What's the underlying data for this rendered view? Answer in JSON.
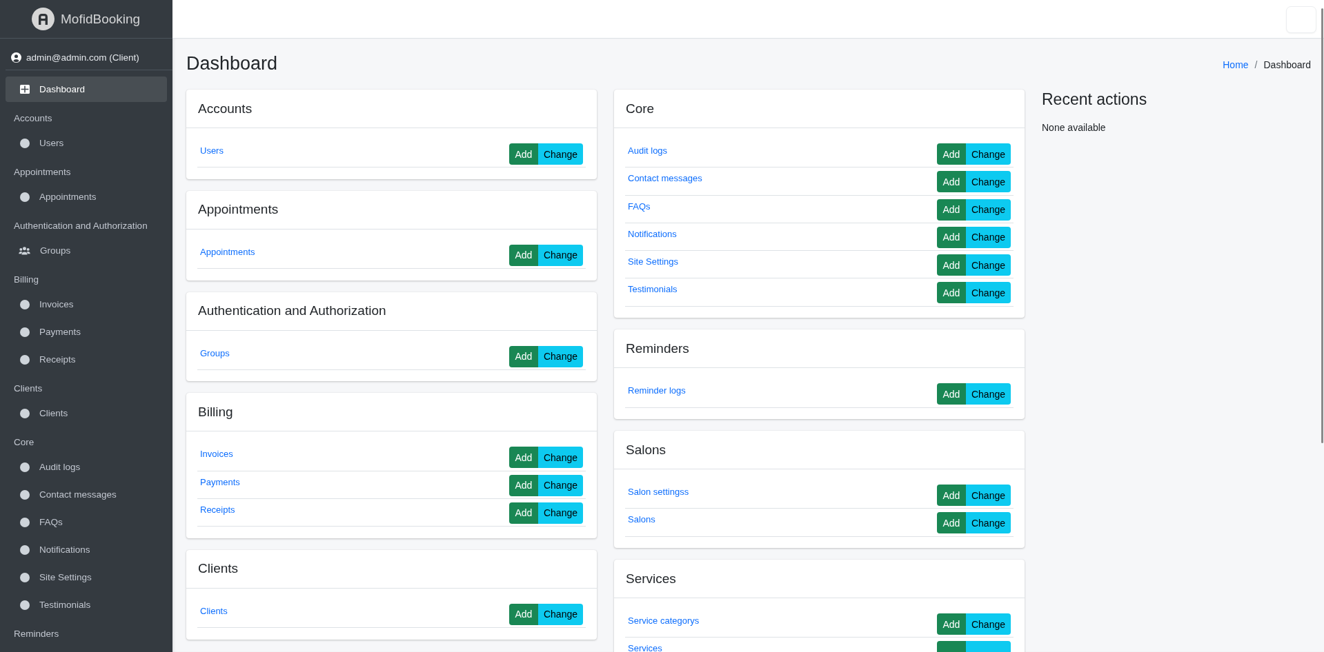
{
  "brand": {
    "name": "MofidBooking"
  },
  "user_panel": {
    "label": "admin@admin.com (Client)"
  },
  "sidebar": {
    "dashboard": {
      "label": "Dashboard",
      "selected": true
    },
    "sections": [
      {
        "title": "Accounts",
        "items": [
          {
            "label": "Users",
            "kind": "model",
            "selected": false
          }
        ]
      },
      {
        "title": "Appointments",
        "items": [
          {
            "label": "Appointments",
            "kind": "model",
            "selected": false
          }
        ]
      },
      {
        "title": "Authentication and Authorization",
        "items": [
          {
            "label": "Groups",
            "kind": "group",
            "selected": false
          }
        ]
      },
      {
        "title": "Billing",
        "items": [
          {
            "label": "Invoices",
            "kind": "model",
            "selected": false
          },
          {
            "label": "Payments",
            "kind": "model",
            "selected": false
          },
          {
            "label": "Receipts",
            "kind": "model",
            "selected": false
          }
        ]
      },
      {
        "title": "Clients",
        "items": [
          {
            "label": "Clients",
            "kind": "model",
            "selected": false
          }
        ]
      },
      {
        "title": "Core",
        "items": [
          {
            "label": "Audit logs",
            "kind": "model",
            "selected": false
          },
          {
            "label": "Contact messages",
            "kind": "model",
            "selected": false
          },
          {
            "label": "FAQs",
            "kind": "model",
            "selected": false
          },
          {
            "label": "Notifications",
            "kind": "model",
            "selected": false
          },
          {
            "label": "Site Settings",
            "kind": "model",
            "selected": false
          },
          {
            "label": "Testimonials",
            "kind": "model",
            "selected": false
          }
        ]
      },
      {
        "title": "Reminders"
      }
    ]
  },
  "page": {
    "title": "Dashboard",
    "breadcrumb": {
      "items": [
        {
          "label": "Home",
          "kind": "link"
        },
        {
          "label": "Dashboard",
          "kind": "current"
        }
      ],
      "separator": "/"
    }
  },
  "app_columns": [
    {
      "cards": [
        {
          "title": "Accounts",
          "rows": [
            {
              "model": "Users",
              "actions": [
                {
                  "label": "Add",
                  "kind": "add"
                },
                {
                  "label": "Change",
                  "kind": "change"
                }
              ]
            }
          ]
        },
        {
          "title": "Appointments",
          "rows": [
            {
              "model": "Appointments",
              "actions": [
                {
                  "label": "Add",
                  "kind": "add"
                },
                {
                  "label": "Change",
                  "kind": "change"
                }
              ]
            }
          ]
        },
        {
          "title": "Authentication and Authorization",
          "rows": [
            {
              "model": "Groups",
              "actions": [
                {
                  "label": "Add",
                  "kind": "add"
                },
                {
                  "label": "Change",
                  "kind": "change"
                }
              ]
            }
          ]
        },
        {
          "title": "Billing",
          "rows": [
            {
              "model": "Invoices",
              "actions": [
                {
                  "label": "Add",
                  "kind": "add"
                },
                {
                  "label": "Change",
                  "kind": "change"
                }
              ]
            },
            {
              "model": "Payments",
              "actions": [
                {
                  "label": "Add",
                  "kind": "add"
                },
                {
                  "label": "Change",
                  "kind": "change"
                }
              ]
            },
            {
              "model": "Receipts",
              "actions": [
                {
                  "label": "Add",
                  "kind": "add"
                },
                {
                  "label": "Change",
                  "kind": "change"
                }
              ]
            }
          ]
        },
        {
          "title": "Clients",
          "rows": [
            {
              "model": "Clients",
              "actions": [
                {
                  "label": "Add",
                  "kind": "add"
                },
                {
                  "label": "Change",
                  "kind": "change"
                }
              ]
            }
          ]
        }
      ]
    },
    {
      "cards": [
        {
          "title": "Core",
          "rows": [
            {
              "model": "Audit logs",
              "actions": [
                {
                  "label": "Add",
                  "kind": "add"
                },
                {
                  "label": "Change",
                  "kind": "change"
                }
              ]
            },
            {
              "model": "Contact messages",
              "actions": [
                {
                  "label": "Add",
                  "kind": "add"
                },
                {
                  "label": "Change",
                  "kind": "change"
                }
              ]
            },
            {
              "model": "FAQs",
              "actions": [
                {
                  "label": "Add",
                  "kind": "add"
                },
                {
                  "label": "Change",
                  "kind": "change"
                }
              ]
            },
            {
              "model": "Notifications",
              "actions": [
                {
                  "label": "Add",
                  "kind": "add"
                },
                {
                  "label": "Change",
                  "kind": "change"
                }
              ]
            },
            {
              "model": "Site Settings",
              "actions": [
                {
                  "label": "Add",
                  "kind": "add"
                },
                {
                  "label": "Change",
                  "kind": "change"
                }
              ]
            },
            {
              "model": "Testimonials",
              "actions": [
                {
                  "label": "Add",
                  "kind": "add"
                },
                {
                  "label": "Change",
                  "kind": "change"
                }
              ]
            }
          ]
        },
        {
          "title": "Reminders",
          "rows": [
            {
              "model": "Reminder logs",
              "actions": [
                {
                  "label": "Add",
                  "kind": "add"
                },
                {
                  "label": "Change",
                  "kind": "change"
                }
              ]
            }
          ]
        },
        {
          "title": "Salons",
          "rows": [
            {
              "model": "Salon settingss",
              "actions": [
                {
                  "label": "Add",
                  "kind": "add"
                },
                {
                  "label": "Change",
                  "kind": "change"
                }
              ]
            },
            {
              "model": "Salons",
              "actions": [
                {
                  "label": "Add",
                  "kind": "add"
                },
                {
                  "label": "Change",
                  "kind": "change"
                }
              ]
            }
          ]
        },
        {
          "title": "Services",
          "rows": [
            {
              "model": "Service categorys",
              "actions": [
                {
                  "label": "Add",
                  "kind": "add"
                },
                {
                  "label": "Change",
                  "kind": "change"
                }
              ]
            },
            {
              "model": "Services",
              "actions": [
                {
                  "kind": "add"
                },
                {
                  "kind": "change"
                }
              ]
            }
          ]
        }
      ]
    }
  ],
  "recent_actions": {
    "title": "Recent actions",
    "empty_text": "None available"
  }
}
